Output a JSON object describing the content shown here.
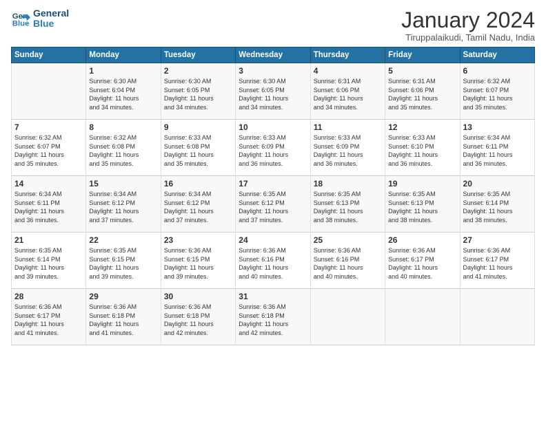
{
  "header": {
    "logo_line1": "General",
    "logo_line2": "Blue",
    "month_title": "January 2024",
    "subtitle": "Tiruppalaikudi, Tamil Nadu, India"
  },
  "days_of_week": [
    "Sunday",
    "Monday",
    "Tuesday",
    "Wednesday",
    "Thursday",
    "Friday",
    "Saturday"
  ],
  "weeks": [
    [
      {
        "day": "",
        "content": ""
      },
      {
        "day": "1",
        "content": "Sunrise: 6:30 AM\nSunset: 6:04 PM\nDaylight: 11 hours\nand 34 minutes."
      },
      {
        "day": "2",
        "content": "Sunrise: 6:30 AM\nSunset: 6:05 PM\nDaylight: 11 hours\nand 34 minutes."
      },
      {
        "day": "3",
        "content": "Sunrise: 6:30 AM\nSunset: 6:05 PM\nDaylight: 11 hours\nand 34 minutes."
      },
      {
        "day": "4",
        "content": "Sunrise: 6:31 AM\nSunset: 6:06 PM\nDaylight: 11 hours\nand 34 minutes."
      },
      {
        "day": "5",
        "content": "Sunrise: 6:31 AM\nSunset: 6:06 PM\nDaylight: 11 hours\nand 35 minutes."
      },
      {
        "day": "6",
        "content": "Sunrise: 6:32 AM\nSunset: 6:07 PM\nDaylight: 11 hours\nand 35 minutes."
      }
    ],
    [
      {
        "day": "7",
        "content": "Sunrise: 6:32 AM\nSunset: 6:07 PM\nDaylight: 11 hours\nand 35 minutes."
      },
      {
        "day": "8",
        "content": "Sunrise: 6:32 AM\nSunset: 6:08 PM\nDaylight: 11 hours\nand 35 minutes."
      },
      {
        "day": "9",
        "content": "Sunrise: 6:33 AM\nSunset: 6:08 PM\nDaylight: 11 hours\nand 35 minutes."
      },
      {
        "day": "10",
        "content": "Sunrise: 6:33 AM\nSunset: 6:09 PM\nDaylight: 11 hours\nand 36 minutes."
      },
      {
        "day": "11",
        "content": "Sunrise: 6:33 AM\nSunset: 6:09 PM\nDaylight: 11 hours\nand 36 minutes."
      },
      {
        "day": "12",
        "content": "Sunrise: 6:33 AM\nSunset: 6:10 PM\nDaylight: 11 hours\nand 36 minutes."
      },
      {
        "day": "13",
        "content": "Sunrise: 6:34 AM\nSunset: 6:11 PM\nDaylight: 11 hours\nand 36 minutes."
      }
    ],
    [
      {
        "day": "14",
        "content": "Sunrise: 6:34 AM\nSunset: 6:11 PM\nDaylight: 11 hours\nand 36 minutes."
      },
      {
        "day": "15",
        "content": "Sunrise: 6:34 AM\nSunset: 6:12 PM\nDaylight: 11 hours\nand 37 minutes."
      },
      {
        "day": "16",
        "content": "Sunrise: 6:34 AM\nSunset: 6:12 PM\nDaylight: 11 hours\nand 37 minutes."
      },
      {
        "day": "17",
        "content": "Sunrise: 6:35 AM\nSunset: 6:12 PM\nDaylight: 11 hours\nand 37 minutes."
      },
      {
        "day": "18",
        "content": "Sunrise: 6:35 AM\nSunset: 6:13 PM\nDaylight: 11 hours\nand 38 minutes."
      },
      {
        "day": "19",
        "content": "Sunrise: 6:35 AM\nSunset: 6:13 PM\nDaylight: 11 hours\nand 38 minutes."
      },
      {
        "day": "20",
        "content": "Sunrise: 6:35 AM\nSunset: 6:14 PM\nDaylight: 11 hours\nand 38 minutes."
      }
    ],
    [
      {
        "day": "21",
        "content": "Sunrise: 6:35 AM\nSunset: 6:14 PM\nDaylight: 11 hours\nand 39 minutes."
      },
      {
        "day": "22",
        "content": "Sunrise: 6:35 AM\nSunset: 6:15 PM\nDaylight: 11 hours\nand 39 minutes."
      },
      {
        "day": "23",
        "content": "Sunrise: 6:36 AM\nSunset: 6:15 PM\nDaylight: 11 hours\nand 39 minutes."
      },
      {
        "day": "24",
        "content": "Sunrise: 6:36 AM\nSunset: 6:16 PM\nDaylight: 11 hours\nand 40 minutes."
      },
      {
        "day": "25",
        "content": "Sunrise: 6:36 AM\nSunset: 6:16 PM\nDaylight: 11 hours\nand 40 minutes."
      },
      {
        "day": "26",
        "content": "Sunrise: 6:36 AM\nSunset: 6:17 PM\nDaylight: 11 hours\nand 40 minutes."
      },
      {
        "day": "27",
        "content": "Sunrise: 6:36 AM\nSunset: 6:17 PM\nDaylight: 11 hours\nand 41 minutes."
      }
    ],
    [
      {
        "day": "28",
        "content": "Sunrise: 6:36 AM\nSunset: 6:17 PM\nDaylight: 11 hours\nand 41 minutes."
      },
      {
        "day": "29",
        "content": "Sunrise: 6:36 AM\nSunset: 6:18 PM\nDaylight: 11 hours\nand 41 minutes."
      },
      {
        "day": "30",
        "content": "Sunrise: 6:36 AM\nSunset: 6:18 PM\nDaylight: 11 hours\nand 42 minutes."
      },
      {
        "day": "31",
        "content": "Sunrise: 6:36 AM\nSunset: 6:18 PM\nDaylight: 11 hours\nand 42 minutes."
      },
      {
        "day": "",
        "content": ""
      },
      {
        "day": "",
        "content": ""
      },
      {
        "day": "",
        "content": ""
      }
    ]
  ]
}
